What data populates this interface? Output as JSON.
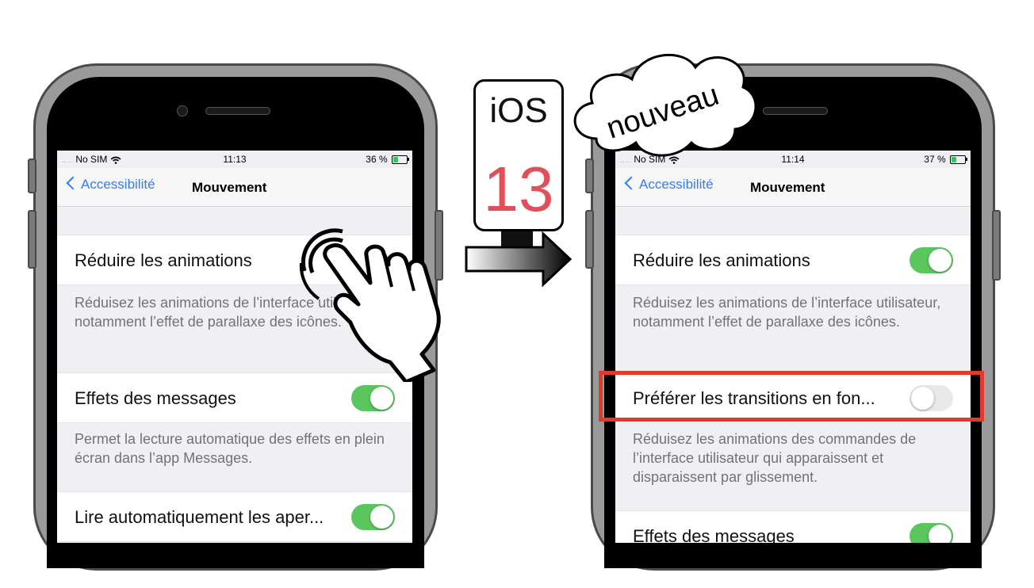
{
  "left_phone": {
    "carrier": "No SIM",
    "time": "11:13",
    "battery": "36 %",
    "battery_level": 0.36,
    "back_label": "Accessibilité",
    "title": "Mouvement",
    "rows": [
      {
        "label": "Réduire les animations",
        "toggle": "obscured"
      },
      {
        "label": "Effets des messages",
        "toggle": "on"
      },
      {
        "label": "Lire automatiquement les aper...",
        "toggle": "on"
      }
    ],
    "footers": [
      "Réduisez les animations de l’interface utilisateur, notamment l’effet de parallaxe des icônes.",
      "Permet la lecture automatique des effets en plein écran dans l’app Messages."
    ]
  },
  "right_phone": {
    "carrier": "No SIM",
    "time": "11:14",
    "battery": "37 %",
    "battery_level": 0.37,
    "back_label": "Accessibilité",
    "title": "Mouvement",
    "rows": [
      {
        "label": "Réduire les animations",
        "toggle": "on"
      },
      {
        "label": "Préférer les transitions en fon...",
        "toggle": "off"
      },
      {
        "label": "Effets des messages",
        "toggle": "on"
      }
    ],
    "footers": [
      "Réduisez les animations de l’interface utilisateur, notamment l’effet de parallaxe des icônes.",
      "Réduisez les animations des commandes de l’interface utilisateur qui apparaissent et disparaissent par glissement."
    ]
  },
  "badge": {
    "os_text": "iOS",
    "version": "13"
  },
  "cloud_text": "nouveau",
  "colors": {
    "toggle_on": "#5cc65e",
    "link": "#2f7ef6",
    "highlight": "#e23b2c"
  },
  "icons": [
    "wifi-icon",
    "battery-icon",
    "chevron-left-icon",
    "hand-tap-icon",
    "arrow-right-icon",
    "cloud-icon"
  ]
}
